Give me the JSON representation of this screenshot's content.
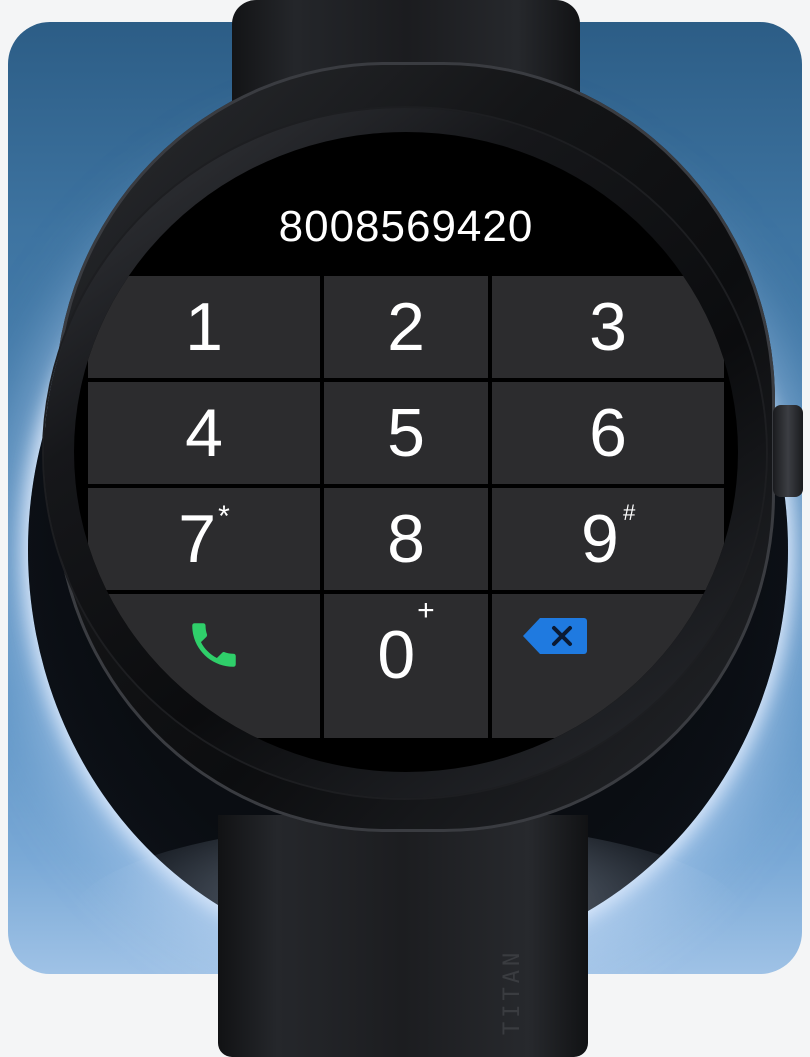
{
  "dialer": {
    "number": "8008569420",
    "keys": [
      {
        "digit": "1",
        "sub": ""
      },
      {
        "digit": "2",
        "sub": ""
      },
      {
        "digit": "3",
        "sub": ""
      },
      {
        "digit": "4",
        "sub": ""
      },
      {
        "digit": "5",
        "sub": ""
      },
      {
        "digit": "6",
        "sub": ""
      },
      {
        "digit": "7",
        "sub": "*"
      },
      {
        "digit": "8",
        "sub": ""
      },
      {
        "digit": "9",
        "sub": "#"
      },
      {
        "digit": "0",
        "sub": "+"
      }
    ],
    "call_icon": "phone-icon",
    "delete_icon": "backspace-icon"
  },
  "strap_text": "TITAN",
  "colors": {
    "key_background": "#2c2c2e",
    "screen_background": "#000000",
    "call_green": "#2fcf6a",
    "delete_blue": "#1f7ae0"
  }
}
